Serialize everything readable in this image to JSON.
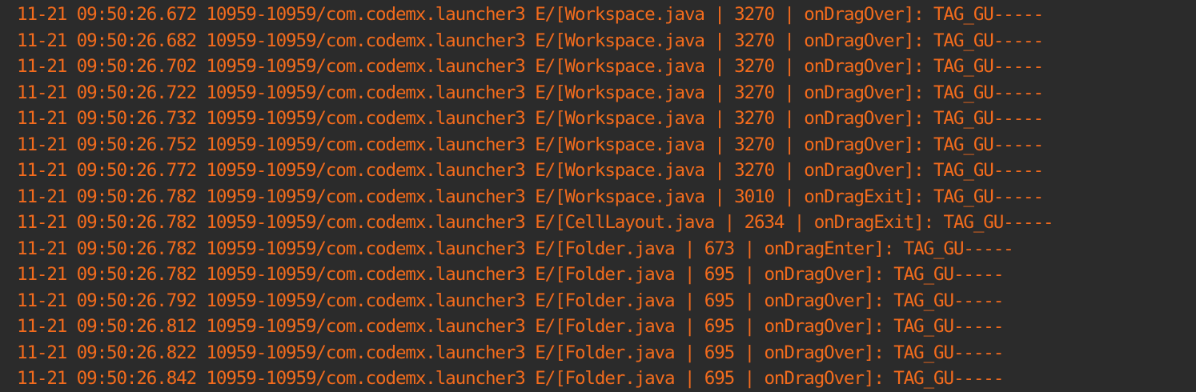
{
  "log_color": "#f26b1d",
  "background_color": "#2b2b2b",
  "lines": [
    "11-21 09:50:26.672 10959-10959/com.codemx.launcher3 E/[Workspace.java | 3270 | onDragOver]: TAG_GU-----",
    "11-21 09:50:26.682 10959-10959/com.codemx.launcher3 E/[Workspace.java | 3270 | onDragOver]: TAG_GU-----",
    "11-21 09:50:26.702 10959-10959/com.codemx.launcher3 E/[Workspace.java | 3270 | onDragOver]: TAG_GU-----",
    "11-21 09:50:26.722 10959-10959/com.codemx.launcher3 E/[Workspace.java | 3270 | onDragOver]: TAG_GU-----",
    "11-21 09:50:26.732 10959-10959/com.codemx.launcher3 E/[Workspace.java | 3270 | onDragOver]: TAG_GU-----",
    "11-21 09:50:26.752 10959-10959/com.codemx.launcher3 E/[Workspace.java | 3270 | onDragOver]: TAG_GU-----",
    "11-21 09:50:26.772 10959-10959/com.codemx.launcher3 E/[Workspace.java | 3270 | onDragOver]: TAG_GU-----",
    "11-21 09:50:26.782 10959-10959/com.codemx.launcher3 E/[Workspace.java | 3010 | onDragExit]: TAG_GU-----",
    "11-21 09:50:26.782 10959-10959/com.codemx.launcher3 E/[CellLayout.java | 2634 | onDragExit]: TAG_GU-----",
    "11-21 09:50:26.782 10959-10959/com.codemx.launcher3 E/[Folder.java | 673 | onDragEnter]: TAG_GU-----",
    "11-21 09:50:26.782 10959-10959/com.codemx.launcher3 E/[Folder.java | 695 | onDragOver]: TAG_GU-----",
    "11-21 09:50:26.792 10959-10959/com.codemx.launcher3 E/[Folder.java | 695 | onDragOver]: TAG_GU-----",
    "11-21 09:50:26.812 10959-10959/com.codemx.launcher3 E/[Folder.java | 695 | onDragOver]: TAG_GU-----",
    "11-21 09:50:26.822 10959-10959/com.codemx.launcher3 E/[Folder.java | 695 | onDragOver]: TAG_GU-----",
    "11-21 09:50:26.842 10959-10959/com.codemx.launcher3 E/[Folder.java | 695 | onDragOver]: TAG_GU-----"
  ]
}
